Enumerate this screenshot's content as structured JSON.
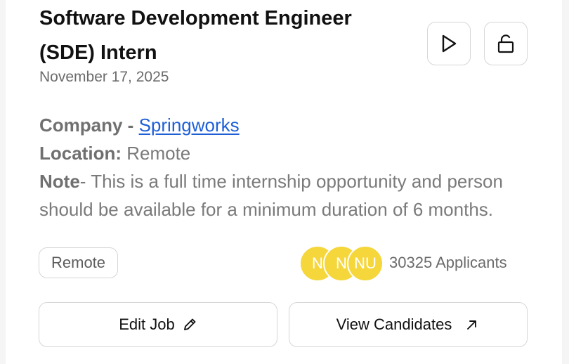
{
  "job": {
    "title": "Software Development Engineer (SDE) Intern",
    "date": "November 17, 2025"
  },
  "header_actions": {
    "play_icon": "play-icon",
    "lock_icon": "unlock-icon"
  },
  "details": {
    "company_label": "Company - ",
    "company_name": "Springworks",
    "location_label": "Location:",
    "location_value": " Remote",
    "note_label": "Note",
    "note_text": "- This is a full time internship opportunity and person should be available for a minimum duration of 6 months."
  },
  "tags": [
    "Remote"
  ],
  "applicants": {
    "avatars": [
      "N",
      "N",
      "NU"
    ],
    "avatar_color": "#f5d63b",
    "count_text": "30325 Applicants"
  },
  "actions": {
    "edit_label": "Edit Job",
    "edit_icon": "pencil-icon",
    "view_label": "View Candidates",
    "view_icon": "arrow-up-right-icon"
  },
  "colors": {
    "link": "#1e5fd6",
    "border": "#d6d6d6",
    "muted_text": "#7a7a7a"
  }
}
